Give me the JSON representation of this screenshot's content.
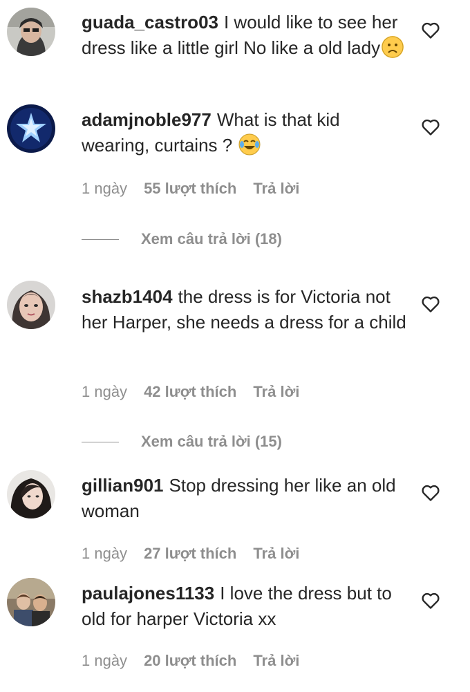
{
  "comments": [
    {
      "username": "guada_castro03",
      "text": "I would like to see her dress like a little girl No like a old lady",
      "emoji": "frowning-face-icon"
    },
    {
      "username": "adamjnoble977",
      "text": "What is that kid wearing, curtains ?",
      "emoji": "tears-of-joy-icon",
      "time": "1 ngày",
      "likes": "55 lượt thích",
      "reply": "Trả lời",
      "view_replies": "Xem câu trả lời (18)"
    },
    {
      "username": "shazb1404",
      "text": "the dress is for Victoria not her Harper, she needs a dress for a child",
      "time": "1 ngày",
      "likes": "42 lượt thích",
      "reply": "Trả lời",
      "view_replies": "Xem câu trả lời (15)"
    },
    {
      "username": "gillian901",
      "text": "Stop dressing her like an old woman",
      "time": "1 ngày",
      "likes": "27 lượt thích",
      "reply": "Trả lời"
    },
    {
      "username": "paulajones1133",
      "text": "I love the dress but to old for harper Victoria xx",
      "time": "1 ngày",
      "likes": "20 lượt thích",
      "reply": "Trả lời"
    }
  ]
}
